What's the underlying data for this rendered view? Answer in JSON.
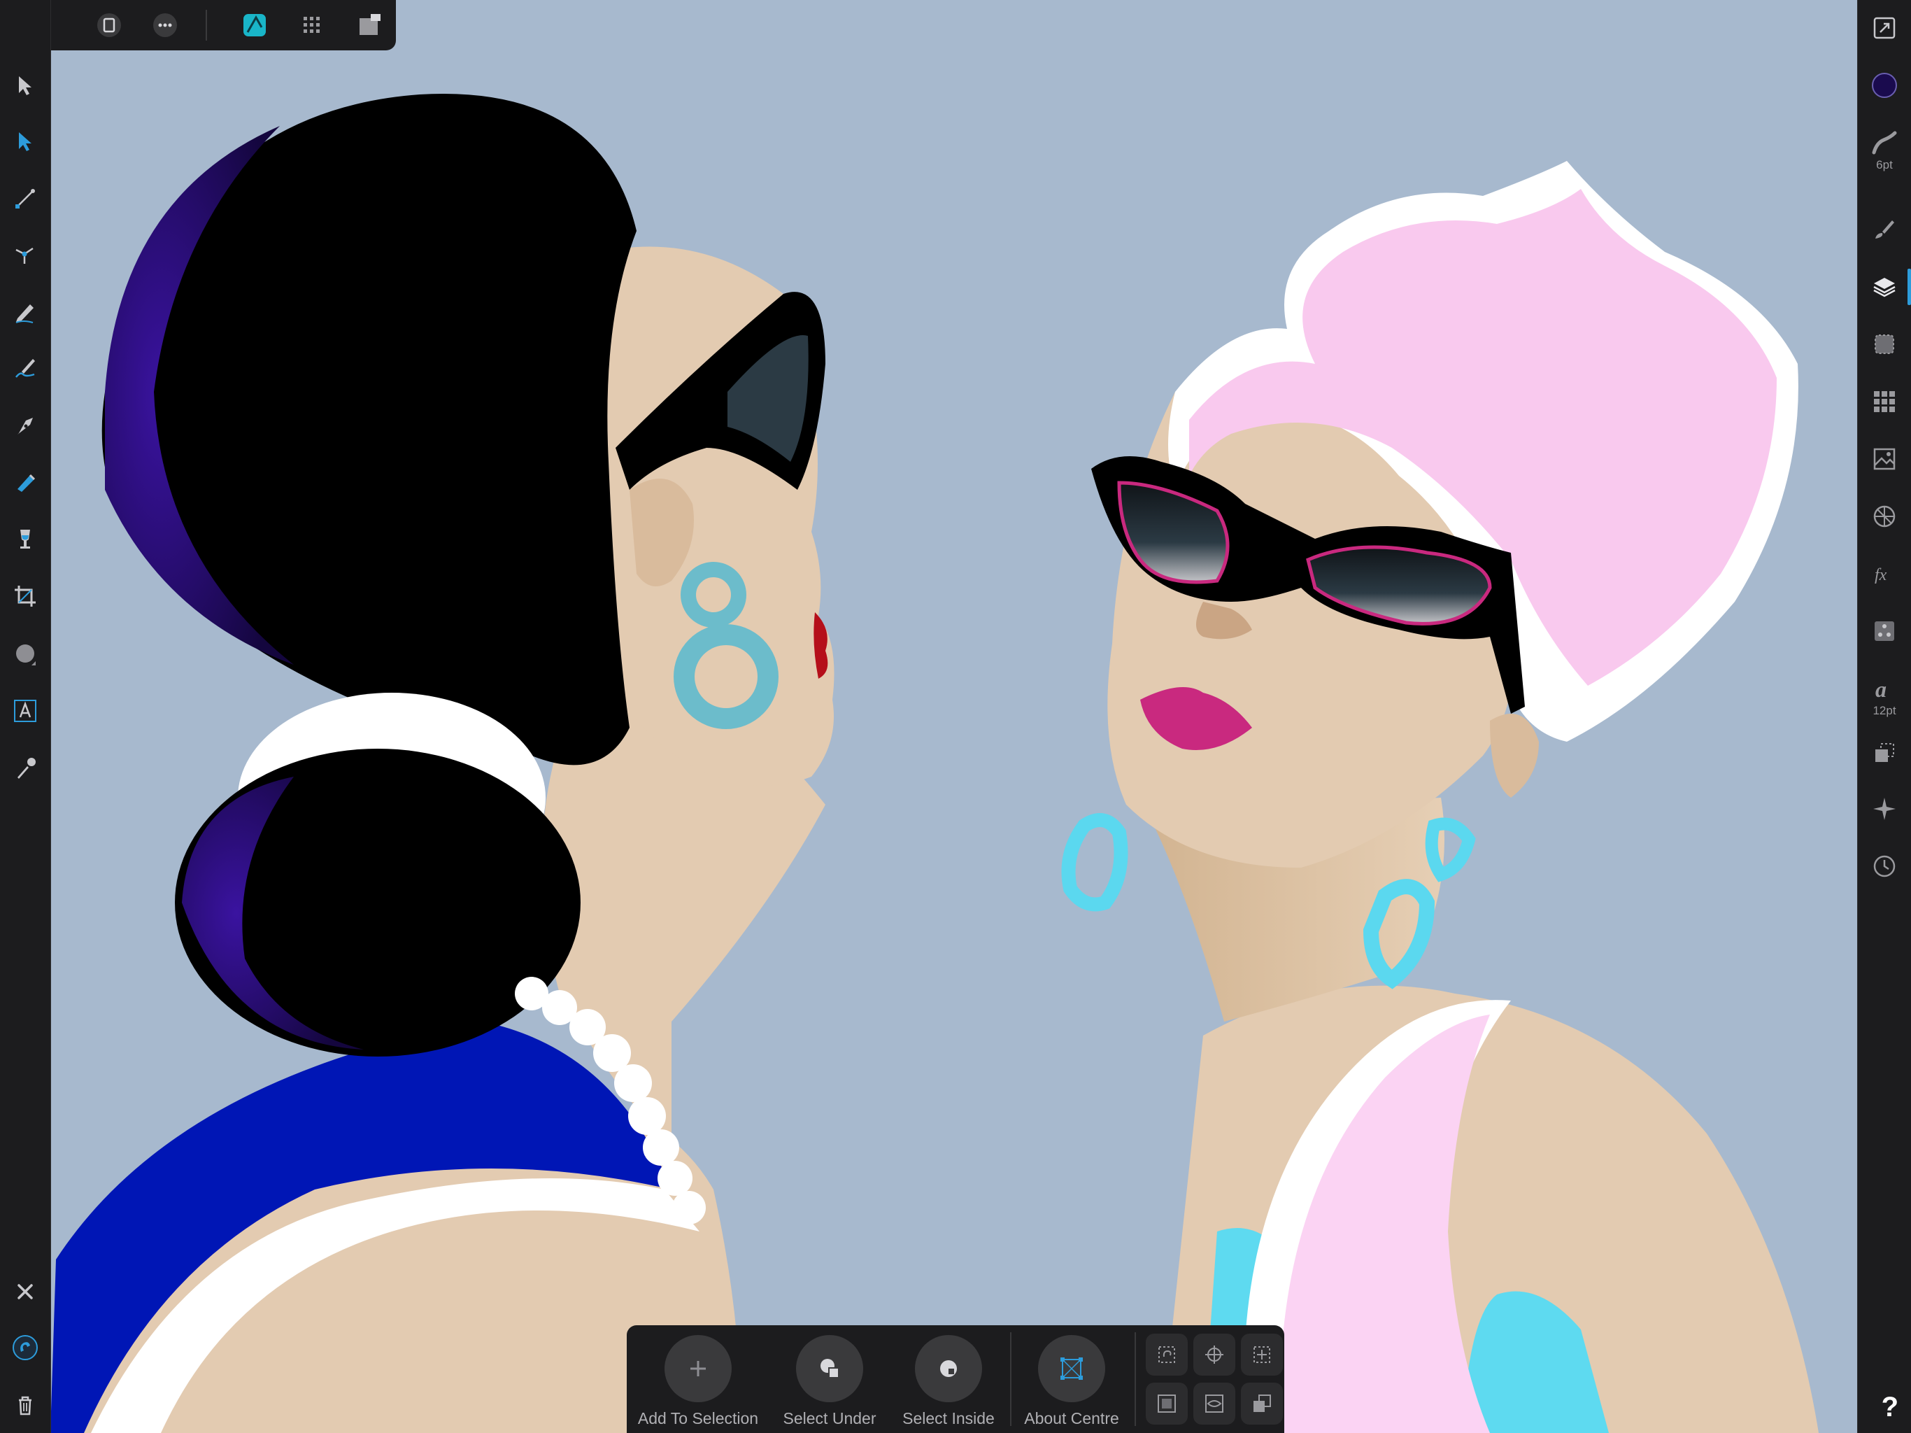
{
  "canvas": {
    "background": "#a7b9ce"
  },
  "colors": {
    "accent": "#2d9cdb",
    "hair_black": "#000000",
    "hair_purple": "#2a0b7a",
    "dress_blue": "#0016b5",
    "skin": "#e3cbb1",
    "earring_teal": "#6cbccb",
    "hair_pink": "#f9c9ee",
    "earring_cyan": "#5bd8ef",
    "lip_magenta": "#c9297f",
    "stripe_pink": "#fbd3f3",
    "cyan_top": "#5edaf0"
  },
  "top_toolbar": {
    "items": [
      "back-arrow-icon",
      "document-icon",
      "more-icon",
      "designer-persona-icon",
      "pixel-persona-icon",
      "export-persona-icon"
    ]
  },
  "left_tools": [
    "move-tool-icon",
    "node-tool-icon",
    "point-transform-tool-icon",
    "corner-tool-icon",
    "pencil-tool-icon",
    "vector-brush-tool-icon",
    "pen-tool-icon",
    "fill-tool-icon",
    "transparency-tool-icon",
    "crop-tool-icon",
    "ellipse-tool-icon",
    "artistic-text-tool-icon",
    "color-picker-tool-icon"
  ],
  "left_bottom": [
    "close-icon",
    "snapping-magnet-icon",
    "trash-icon"
  ],
  "right_studio": {
    "stroke_width": "6pt",
    "text_size": "12pt",
    "items": [
      "view-icon",
      "color-swatch-icon",
      "stroke-icon",
      "brushes-icon",
      "layers-icon",
      "appearance-icon",
      "swatches-icon",
      "stock-icon",
      "adjustments-icon",
      "effects-icon",
      "styles-icon",
      "text-styles-icon",
      "transform-icon",
      "navigator-icon",
      "history-icon"
    ],
    "fill_color": "#1a0b4e"
  },
  "context_toolbar": {
    "buttons": [
      {
        "label": "Add To Selection",
        "icon": "plus-icon"
      },
      {
        "label": "Select Under",
        "icon": "select-under-icon"
      },
      {
        "label": "Select Inside",
        "icon": "select-inside-icon"
      },
      {
        "label": "About Centre",
        "icon": "about-centre-icon"
      }
    ],
    "small_buttons": [
      "lasso-select-icon",
      "crosshair-icon",
      "align-centre-icon",
      "frame-icon",
      "eye-frame-icon",
      "duplicate-icon"
    ]
  },
  "help_label": "?"
}
